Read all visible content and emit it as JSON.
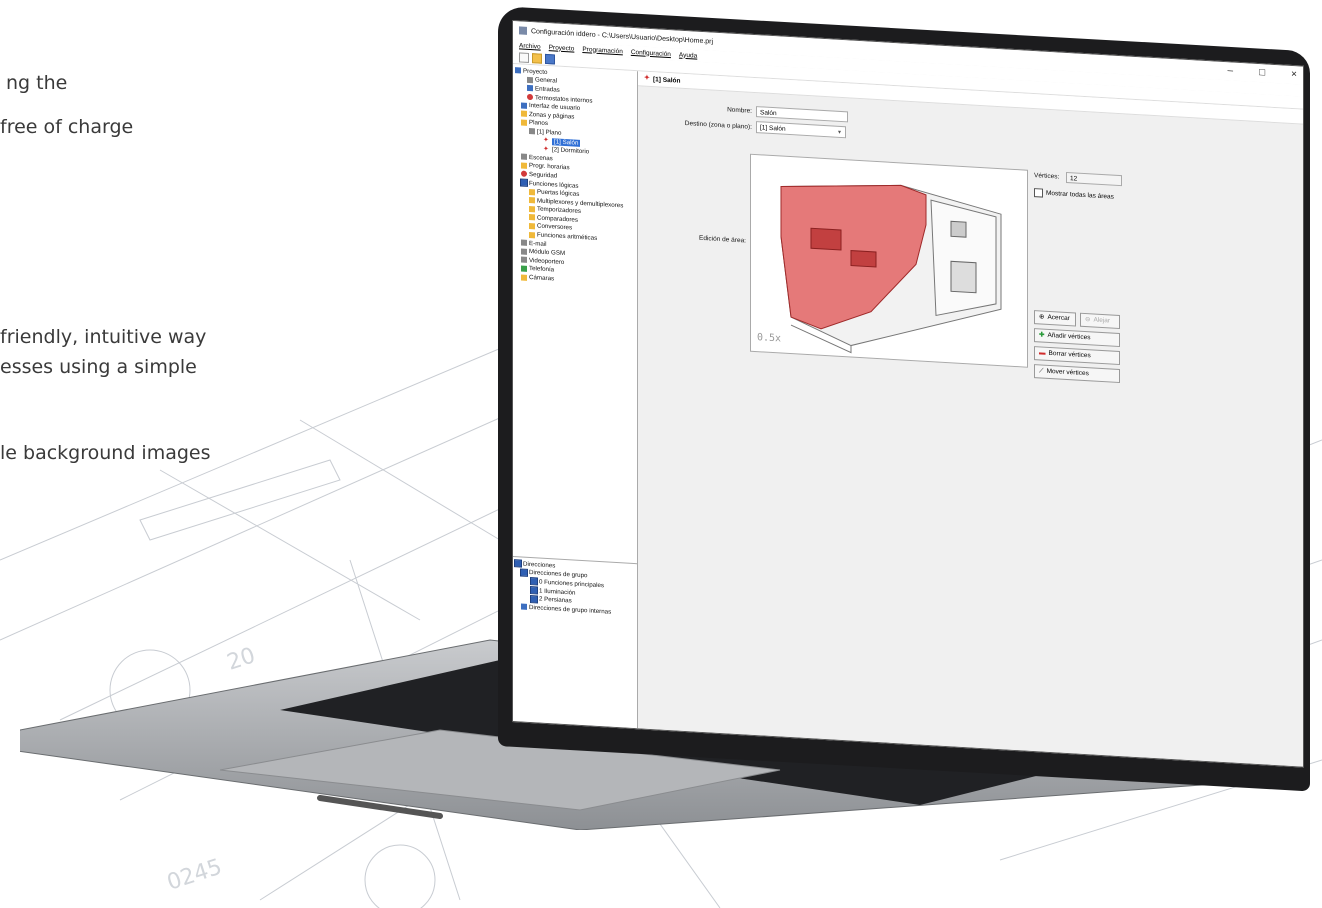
{
  "marketing": {
    "line1": "ng the",
    "line2": "free of charge",
    "line3": "friendly, intuitive way",
    "line4": "esses using a simple",
    "line5": "le background images"
  },
  "window": {
    "title": "Configuración iddero - C:\\Users\\Usuario\\Desktop\\Home.prj",
    "minimize": "–",
    "maximize": "□",
    "close": "×"
  },
  "menu": [
    "Archivo",
    "Proyecto",
    "Programación",
    "Configuración",
    "Ayuda"
  ],
  "tree": {
    "root": "Proyecto",
    "general": "General",
    "entradas": "Entradas",
    "termostatos": "Termostatos internos",
    "interfaz": "Interfaz de usuario",
    "zonas": "Zonas y páginas",
    "planos": "Planos",
    "plano1": "[1] Plano",
    "salon": "[1] Salón",
    "dormitorio": "[2] Dormitorio",
    "escenas": "Escenas",
    "progr": "Progr. horarias",
    "seguridad": "Seguridad",
    "funciones": "Funciones lógicas",
    "puertas": "Puertas lógicas",
    "multiplexores": "Multiplexores y demultiplexores",
    "temporizadores": "Temporizadores",
    "comparadores": "Comparadores",
    "conversores": "Conversores",
    "aritmeticas": "Funciones aritméticas",
    "email": "E-mail",
    "gsm": "Módulo GSM",
    "videoportero": "Videoportero",
    "telefonia": "Telefonía",
    "camaras": "Cámaras"
  },
  "tree2": {
    "direcciones": "Direcciones",
    "grupo": "Direcciones de grupo",
    "g0": "0 Funciones principales",
    "g1": "1 Iluminación",
    "g2": "2 Persianas",
    "internas": "Direcciones de grupo internas"
  },
  "panel": {
    "header": "[1] Salón",
    "nombre_label": "Nombre:",
    "nombre_value": "Salón",
    "destino_label": "Destino (zona o plano):",
    "destino_value": "[1] Salón",
    "edicion_label": "Edición de área:",
    "vertices_label": "Vértices:",
    "vertices_value": "12",
    "mostrar_label": "Mostrar todas las áreas",
    "zoom": "0.5x",
    "acercar": "Acercar",
    "alejar": "Alejar",
    "anadir": "Añadir vértices",
    "borrar": "Borrar vértices",
    "mover": "Mover vértices"
  },
  "colors": {
    "highlight": "#e05050",
    "selection": "#2f6fd6"
  }
}
